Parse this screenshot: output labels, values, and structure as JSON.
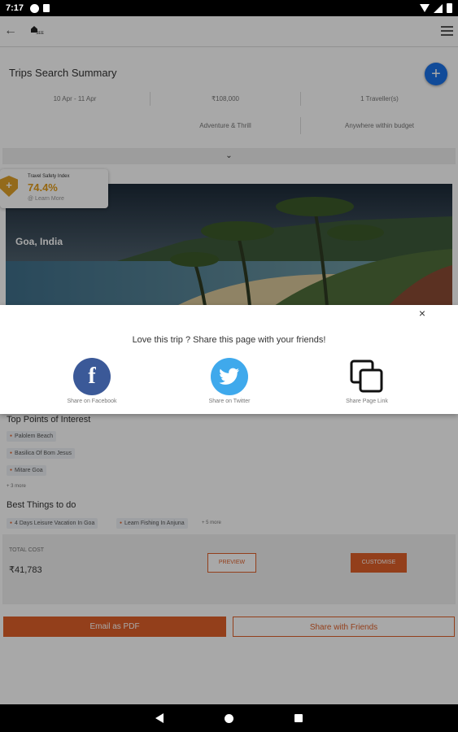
{
  "status_bar": {
    "time": "7:17"
  },
  "header": {
    "logo_text": "SEE"
  },
  "summary": {
    "title": "Trips  Search Summary",
    "dates": "10 Apr - 11 Apr",
    "budget": "₹108,000",
    "travellers": "1 Traveller(s)",
    "theme": "Adventure & Thrill",
    "destination_filter": "Anywhere within budget"
  },
  "safety": {
    "label": "Travel Safety Index",
    "value": "74.4%",
    "learn_more": "@ Learn More"
  },
  "destination": {
    "name": "Goa, India"
  },
  "share_sheet": {
    "prompt": "Love this trip ? Share this page with your friends!",
    "close": "×",
    "options": [
      {
        "label": "Share on Facebook",
        "icon": "facebook-icon"
      },
      {
        "label": "Share on Twitter",
        "icon": "twitter-icon"
      },
      {
        "label": "Share Page Link",
        "icon": "copy-link-icon"
      }
    ]
  },
  "points_of_interest": {
    "title": "Top Points of Interest",
    "items": [
      "Palolem Beach",
      "Basilica Of Bom Jesus",
      "Mitare Goa"
    ],
    "more": "+ 3 more"
  },
  "things_to_do": {
    "title": "Best Things to do",
    "items": [
      "4 Days Leisure Vacation In Goa",
      "Learn Fishing In Anjuna"
    ],
    "more": "+ 5 more"
  },
  "cost": {
    "label": "TOTAL COST",
    "value": "₹41,783",
    "preview_label": "PREVIEW",
    "customise_label": "CUSTOMISE"
  },
  "actions": {
    "email_pdf": "Email as PDF",
    "share_friends": "Share with Friends"
  },
  "colors": {
    "accent": "#e0602a",
    "fab": "#1a73e8",
    "facebook": "#3b5998",
    "twitter": "#3fa9ec",
    "safety": "#e39b17"
  }
}
